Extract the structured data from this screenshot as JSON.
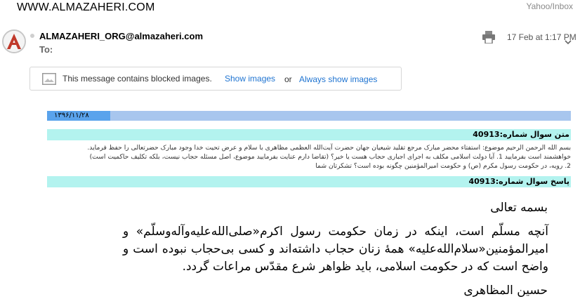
{
  "header": {
    "site_title": "WWW.ALMAZAHERI.COM",
    "source_label": "Yahoo/Inbox"
  },
  "message": {
    "sender": "ALMAZAHERI_ORG@almazaheri.com",
    "to_label": "To:",
    "date": "17 Feb at 1:17 PM",
    "avatar_letter": "A"
  },
  "blocked_images": {
    "text": "This message contains blocked images.",
    "show_images": "Show images",
    "or": "or",
    "always_show": "Always show images"
  },
  "body": {
    "persian_date": "۱۳۹۶/۱۱/۲۸",
    "question_header": "متن سوال شماره:40913",
    "question_lines": [
      "بسم الله الرحمن الرحيم موضوع: استفتاء محضر مبارک مرجع تقليد شيعيان جهان حضرت آيت‌الله العظمی مظاهری با سلام و عرض تحيت خدا وجود مبارک حضرتعالی را حفظ فرمايد.",
      "خواهشمند است بفرماييد 1. آيا دولت اسلامی مکلف به اجرای اجباری حجاب هست يا خير؟ (تقاضا دارم عنايت بفرماييد موضوع، اصل مسئله حجاب نيست، بلکه تکليف حاکميت است)",
      "2. رويه، در حکومت رسول مکرم (ص) و حکومت اميرالمؤمنين چگونه بوده است؟ تشکرتان شما"
    ],
    "answer_header": "پاسخ سوال شماره:40913",
    "answer_title": "بسمه تعالی",
    "answer_text": "آنچه مسلّم است، اينکه در زمان حکومت رسول اکرم«صلی‌الله‌عليه‌وآله‌وسلّم» و اميرالمؤمنين«سلام‌الله‌عليه» همهٔ زنان حجاب داشته‌اند و کسی بی‌حجاب نبوده است و واضح است که در حکومت اسلامی، بايد ظواهر شرع مقدّس مراعات گردد.",
    "signature": "حسين المظاهری"
  },
  "colors": {
    "link": "#1f74d1",
    "date_bar": "#a8c6ee",
    "date_bar_fill": "#5aa3ec",
    "header_bar": "#b3f3ef",
    "avatar_red": "#c0392b"
  },
  "icons": [
    "avatar-logo",
    "status-dot",
    "print-icon",
    "more-chevron-icon",
    "image-icon"
  ]
}
